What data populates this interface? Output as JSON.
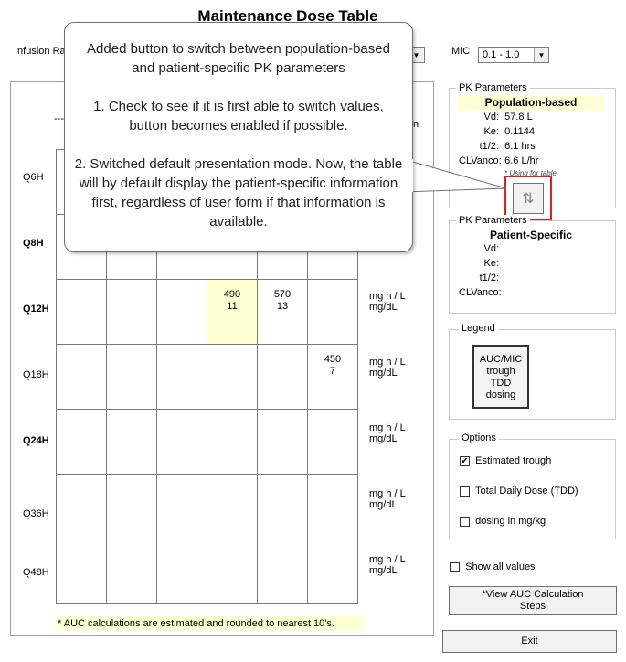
{
  "window": {
    "title": "Maintenance Dose Table"
  },
  "controls": {
    "infusion_label": "Infusion Ra",
    "mic_label": "MIC",
    "mic_value": "0.1 - 1.0",
    "column_header_left": "---",
    "column_header_right": "n"
  },
  "rows": [
    {
      "label": "Q6H",
      "bold": false,
      "cells": [
        "",
        "",
        "",
        "",
        "",
        ""
      ],
      "units": [
        "",
        ""
      ]
    },
    {
      "label": "Q8H",
      "bold": true,
      "cells": [
        "",
        "",
        "",
        "",
        "",
        ""
      ],
      "units": [
        "",
        ""
      ]
    },
    {
      "label": "Q12H",
      "bold": true,
      "cells": [
        "",
        "",
        "",
        "490\n11",
        "570\n13",
        ""
      ],
      "units": [
        "mg h / L",
        "mg/dL"
      ]
    },
    {
      "label": "Q18H",
      "bold": false,
      "cells": [
        "",
        "",
        "",
        "",
        "",
        "450\n7"
      ],
      "units": [
        "mg h / L",
        "mg/dL"
      ]
    },
    {
      "label": "Q24H",
      "bold": true,
      "cells": [
        "",
        "",
        "",
        "",
        "",
        ""
      ],
      "units": [
        "mg h / L",
        "mg/dL"
      ]
    },
    {
      "label": "Q36H",
      "bold": false,
      "cells": [
        "",
        "",
        "",
        "",
        "",
        ""
      ],
      "units": [
        "mg h / L",
        "mg/dL"
      ]
    },
    {
      "label": "Q48H",
      "bold": false,
      "cells": [
        "",
        "",
        "",
        "",
        "",
        ""
      ],
      "units": [
        "mg h / L",
        "mg/dL"
      ]
    }
  ],
  "footnote": "* AUC calculations are estimated and rounded to nearest 10's.",
  "pk_population": {
    "group_label": "PK Parameters",
    "heading": "Population-based",
    "vd_label": "Vd:",
    "vd_value": "57.8 L",
    "ke_label": "Ke:",
    "ke_value": "0.1144",
    "t12_label": "t1/2:",
    "t12_value": "6.1 hrs",
    "cl_label": "CLVanco:",
    "cl_value": "6.6 L/hr",
    "using_note": "* Using for table"
  },
  "pk_patient": {
    "group_label": "PK Parameters",
    "heading": "Patient-Specific",
    "vd_label": "Vd:",
    "ke_label": "Ke:",
    "t12_label": "t1/2:",
    "cl_label": "CLVanco:"
  },
  "switch_button": {
    "icon": "swap-vertical-icon",
    "glyph": "⇅",
    "highlight_color": "#e02020"
  },
  "legend": {
    "group_label": "Legend",
    "lines": [
      "AUC/MIC",
      "trough",
      "TDD",
      "dosing"
    ]
  },
  "options": {
    "group_label": "Options",
    "items": [
      {
        "label": "Estimated trough",
        "checked": true
      },
      {
        "label": "Total Daily  Dose (TDD)",
        "checked": false
      },
      {
        "label": "dosing in mg/kg",
        "checked": false
      }
    ]
  },
  "show_all": {
    "label": "Show all values",
    "checked": false
  },
  "view_auc_button": {
    "line1": "*View AUC Calculation",
    "line2": "Steps"
  },
  "exit_button": {
    "label": "Exit"
  },
  "callout": {
    "p1": "Added button to switch between population-based and patient-specific PK parameters",
    "p2": "1. Check to see if it is first able to switch values, button becomes enabled if possible.",
    "p3": "2. Switched default presentation mode.  Now, the table will by default display the patient-specific information first, regardless of user form if that information is available."
  },
  "colors": {
    "highlight_cell": "#ffffd6",
    "annotation_red": "#e02020"
  }
}
